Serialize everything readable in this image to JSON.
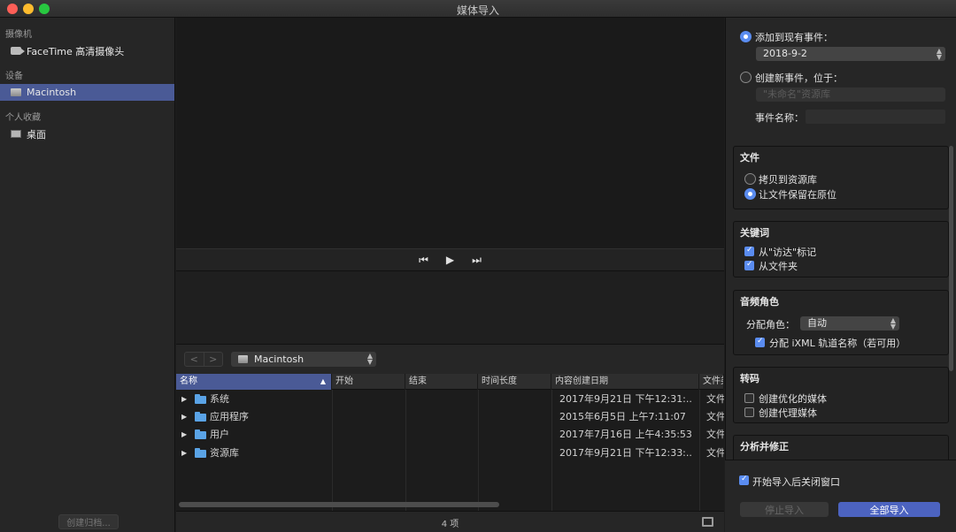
{
  "window": {
    "title": "媒体导入"
  },
  "sidebar": {
    "sections": [
      {
        "header": "摄像机",
        "items": [
          {
            "label": "FaceTime 高清摄像头",
            "icon": "camera-icon"
          }
        ]
      },
      {
        "header": "设备",
        "items": [
          {
            "label": "Macintosh",
            "icon": "disk-icon",
            "selected": true
          }
        ]
      },
      {
        "header": "个人收藏",
        "items": [
          {
            "label": "桌面",
            "icon": "desktop-icon"
          }
        ]
      }
    ],
    "create_archive_label": "创建归档..."
  },
  "browser": {
    "nav_back": "<",
    "nav_forward": ">",
    "location": "Macintosh",
    "columns": [
      "名称",
      "开始",
      "结束",
      "时间长度",
      "内容创建日期",
      "文件类"
    ],
    "rows": [
      {
        "name": "系统",
        "start": "",
        "end": "",
        "duration": "",
        "created": "2017年9月21日 下午12:31:...",
        "type": "文件"
      },
      {
        "name": "应用程序",
        "start": "",
        "end": "",
        "duration": "",
        "created": "2015年6月5日 上午7:11:07",
        "type": "文件"
      },
      {
        "name": "用户",
        "start": "",
        "end": "",
        "duration": "",
        "created": "2017年7月16日 上午4:35:53",
        "type": "文件"
      },
      {
        "name": "资源库",
        "start": "",
        "end": "",
        "duration": "",
        "created": "2017年9月21日 下午12:33:...",
        "type": "文件"
      }
    ],
    "count": "4 项"
  },
  "options": {
    "add_to_event_label": "添加到现有事件：",
    "existing_event": "2018-9-2",
    "new_event_label": "创建新事件，位于：",
    "new_event_library": "\"未命名\"资源库",
    "event_name_label": "事件名称：",
    "files": {
      "title": "文件",
      "copy_label": "拷贝到资源库",
      "leave_label": "让文件保留在原位"
    },
    "keywords": {
      "title": "关键词",
      "finder_tags_label": "从\"访达\"标记",
      "folders_label": "从文件夹"
    },
    "audio_roles": {
      "title": "音频角色",
      "assign_label": "分配角色：",
      "assign_value": "自动",
      "ixml_label": "分配 iXML 轨道名称（若可用）"
    },
    "transcode": {
      "title": "转码",
      "optimized_label": "创建优化的媒体",
      "proxy_label": "创建代理媒体"
    },
    "analyze": {
      "title": "分析并修正"
    },
    "close_after_label": "开始导入后关闭窗口",
    "stop_label": "停止导入",
    "import_all_label": "全部导入"
  },
  "colors": {
    "accent": "#5a8cf0",
    "selection": "#4a5a96",
    "import_button": "#4c63c0"
  }
}
